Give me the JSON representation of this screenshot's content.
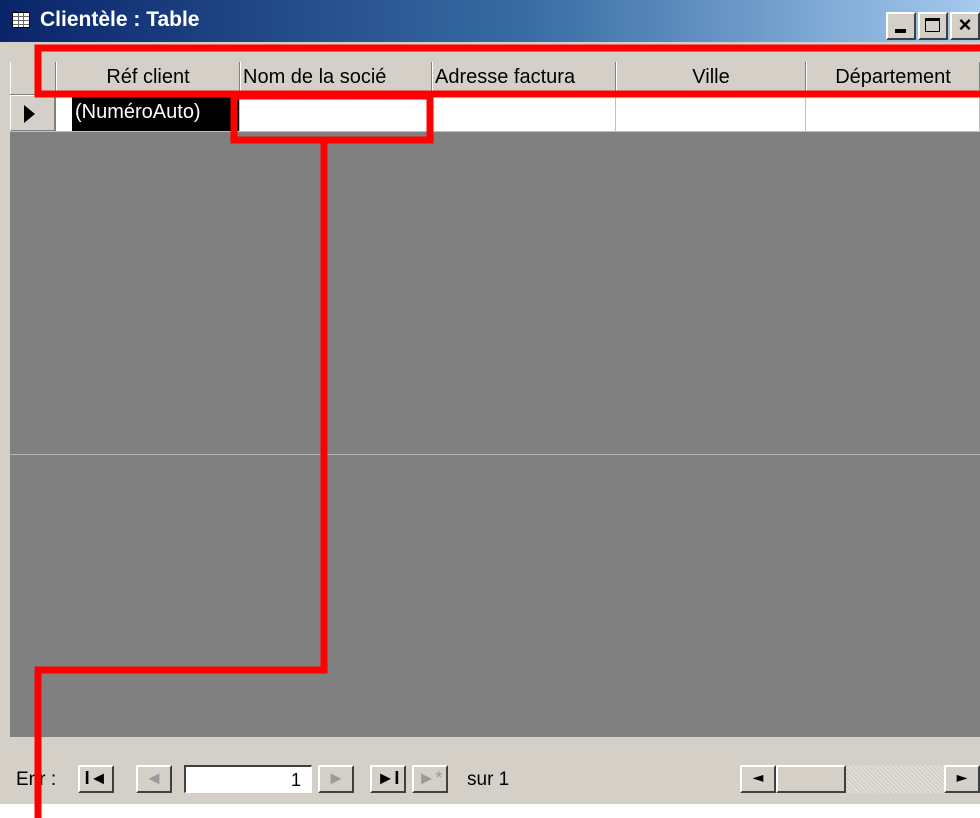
{
  "window": {
    "title": "Clientèle : Table",
    "controls": {
      "minimize_icon": "minimize-icon",
      "maximize_icon": "maximize-icon",
      "close_glyph": "×"
    }
  },
  "grid": {
    "columns": [
      "Réf client",
      "Nom de la socié",
      "Adresse factura",
      "Ville",
      "Département"
    ],
    "new_row": {
      "autonumber": "(NuméroAuto)",
      "cells": [
        "",
        "",
        "",
        ""
      ]
    }
  },
  "navigation": {
    "label": "Enr :",
    "first": "I◄",
    "prev": "◄",
    "current_record": "1",
    "next": "►",
    "last": "►I",
    "new": "►*",
    "total_text": "sur 1",
    "scroll_left": "◄",
    "scroll_right": "►"
  },
  "colors": {
    "annotation": "#ff0000",
    "titlebar": "#0a246a",
    "empty_area": "#808080"
  }
}
